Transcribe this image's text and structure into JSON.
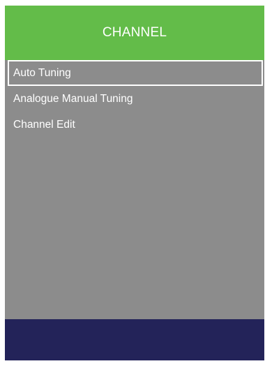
{
  "header": {
    "title": "CHANNEL"
  },
  "menu": {
    "selected_index": 0,
    "items": [
      {
        "label": "Auto Tuning"
      },
      {
        "label": "Analogue Manual Tuning"
      },
      {
        "label": "Channel Edit"
      }
    ]
  },
  "colors": {
    "header_bg": "#63bc49",
    "panel_bg": "#8c8c8c",
    "footer_bg": "#232359",
    "text": "#ffffff",
    "selection_border": "#ffffff"
  }
}
